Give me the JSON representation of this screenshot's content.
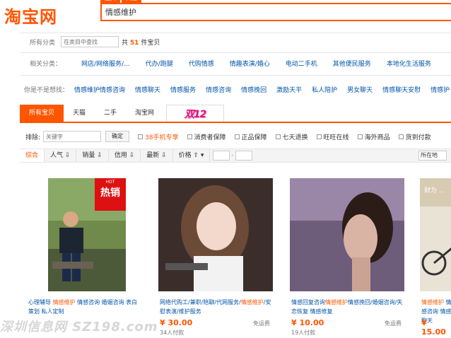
{
  "header": {
    "logo": "淘宝网",
    "search_tabs": [
      "宝贝",
      "天猫"
    ],
    "search_value": "情感维护"
  },
  "category_row": {
    "label": "所有分类",
    "input_placeholder": "在类目中查找",
    "count_prefix": "共",
    "count_value": "51",
    "count_suffix": "件宝贝"
  },
  "related_row": {
    "label": "相关分类：",
    "items": [
      "网店/网络服务/...",
      "代办/跑腿",
      "代购情感",
      "情趣表演/婚心",
      "电动二手机",
      "其他便民服务",
      "本地化生活服务"
    ]
  },
  "maybe_row": {
    "label": "你是不是想找：",
    "items": [
      "情感维护情感咨询",
      "情感聊天",
      "情感服务",
      "情感咨询",
      "情感挽回",
      "激励天平",
      "私人陪护",
      "男女聊天",
      "情感聊天安慰",
      "情感护"
    ]
  },
  "tabs": {
    "items": [
      "所有宝贝",
      "天猫",
      "二手",
      "淘宝网"
    ],
    "promo": "双12"
  },
  "filter_row": {
    "label": "排除:",
    "input_placeholder": "关键字",
    "ok_label": "确定",
    "options": [
      "38手机专享",
      "消费者保障",
      "正品保障",
      "七天退换",
      "货到付款",
      "旺旺在线",
      "海外商品",
      "货到付款"
    ]
  },
  "sort_row": {
    "items": [
      "综合",
      "人气 ⇩",
      "销量 ⇩",
      "信用 ⇩",
      "最新 ⇩",
      "价格 ⇧ ▾"
    ],
    "location": "所在地"
  },
  "products": [
    {
      "title_prefix": "心理辅导 ",
      "title_hl": "情感维护",
      "title_rest": " 情感咨询 婚姻咨询 表白策划 私人定制",
      "price": "",
      "shipping": "",
      "sold": "",
      "badge_small": "HOT",
      "badge_big": "热销"
    },
    {
      "title_prefix": "网络代购工/兼职/陪聊/代网服务/",
      "title_hl": "情感维护",
      "title_rest": "/安慰表演/维护服务",
      "price": "¥ 30.00",
      "shipping": "免运费",
      "sold": "34人付款"
    },
    {
      "title_prefix": "情感回复咨询",
      "title_hl": "情感维护",
      "title_rest": "情感挽回/婚姻咨询/失恋恢复 情感修复",
      "price": "¥ 10.00",
      "shipping": "免运费",
      "sold": "19人付款"
    },
    {
      "title_prefix": "",
      "title_hl": "情感维护",
      "title_rest": " 情感咨询 情感聊天",
      "price": "¥ 15.00",
      "shipping": "",
      "sold": "",
      "banner": "财为 ..."
    }
  ],
  "watermark": "深圳信息网 SZ198.com"
}
